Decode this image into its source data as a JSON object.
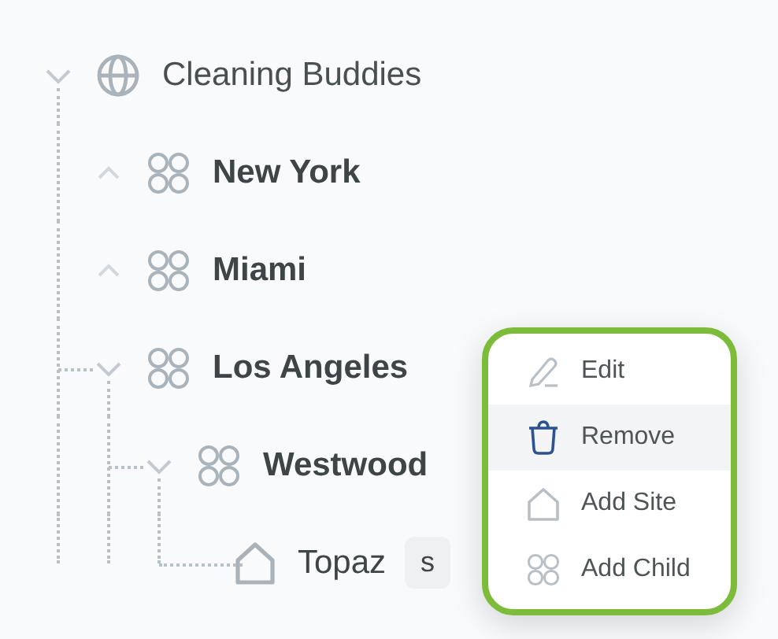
{
  "tree": [
    {
      "label": "Cleaning Buddies",
      "kind": "org",
      "expanded": true,
      "children": [
        {
          "label": "New York",
          "kind": "group",
          "expanded": false
        },
        {
          "label": "Miami",
          "kind": "group",
          "expanded": false
        },
        {
          "label": "Los Angeles",
          "kind": "group",
          "expanded": true,
          "children": [
            {
              "label": "Westwood",
              "kind": "group",
              "expanded": true,
              "children": [
                {
                  "label": "Topaz",
                  "kind": "site",
                  "badge": "s"
                }
              ]
            }
          ]
        }
      ]
    }
  ],
  "menu": [
    {
      "label": "Edit",
      "kind": "edit",
      "selected": false
    },
    {
      "label": "Remove",
      "kind": "remove",
      "selected": true
    },
    {
      "label": "Add Site",
      "kind": "site",
      "selected": false
    },
    {
      "label": "Add Child",
      "kind": "child",
      "selected": false
    }
  ]
}
